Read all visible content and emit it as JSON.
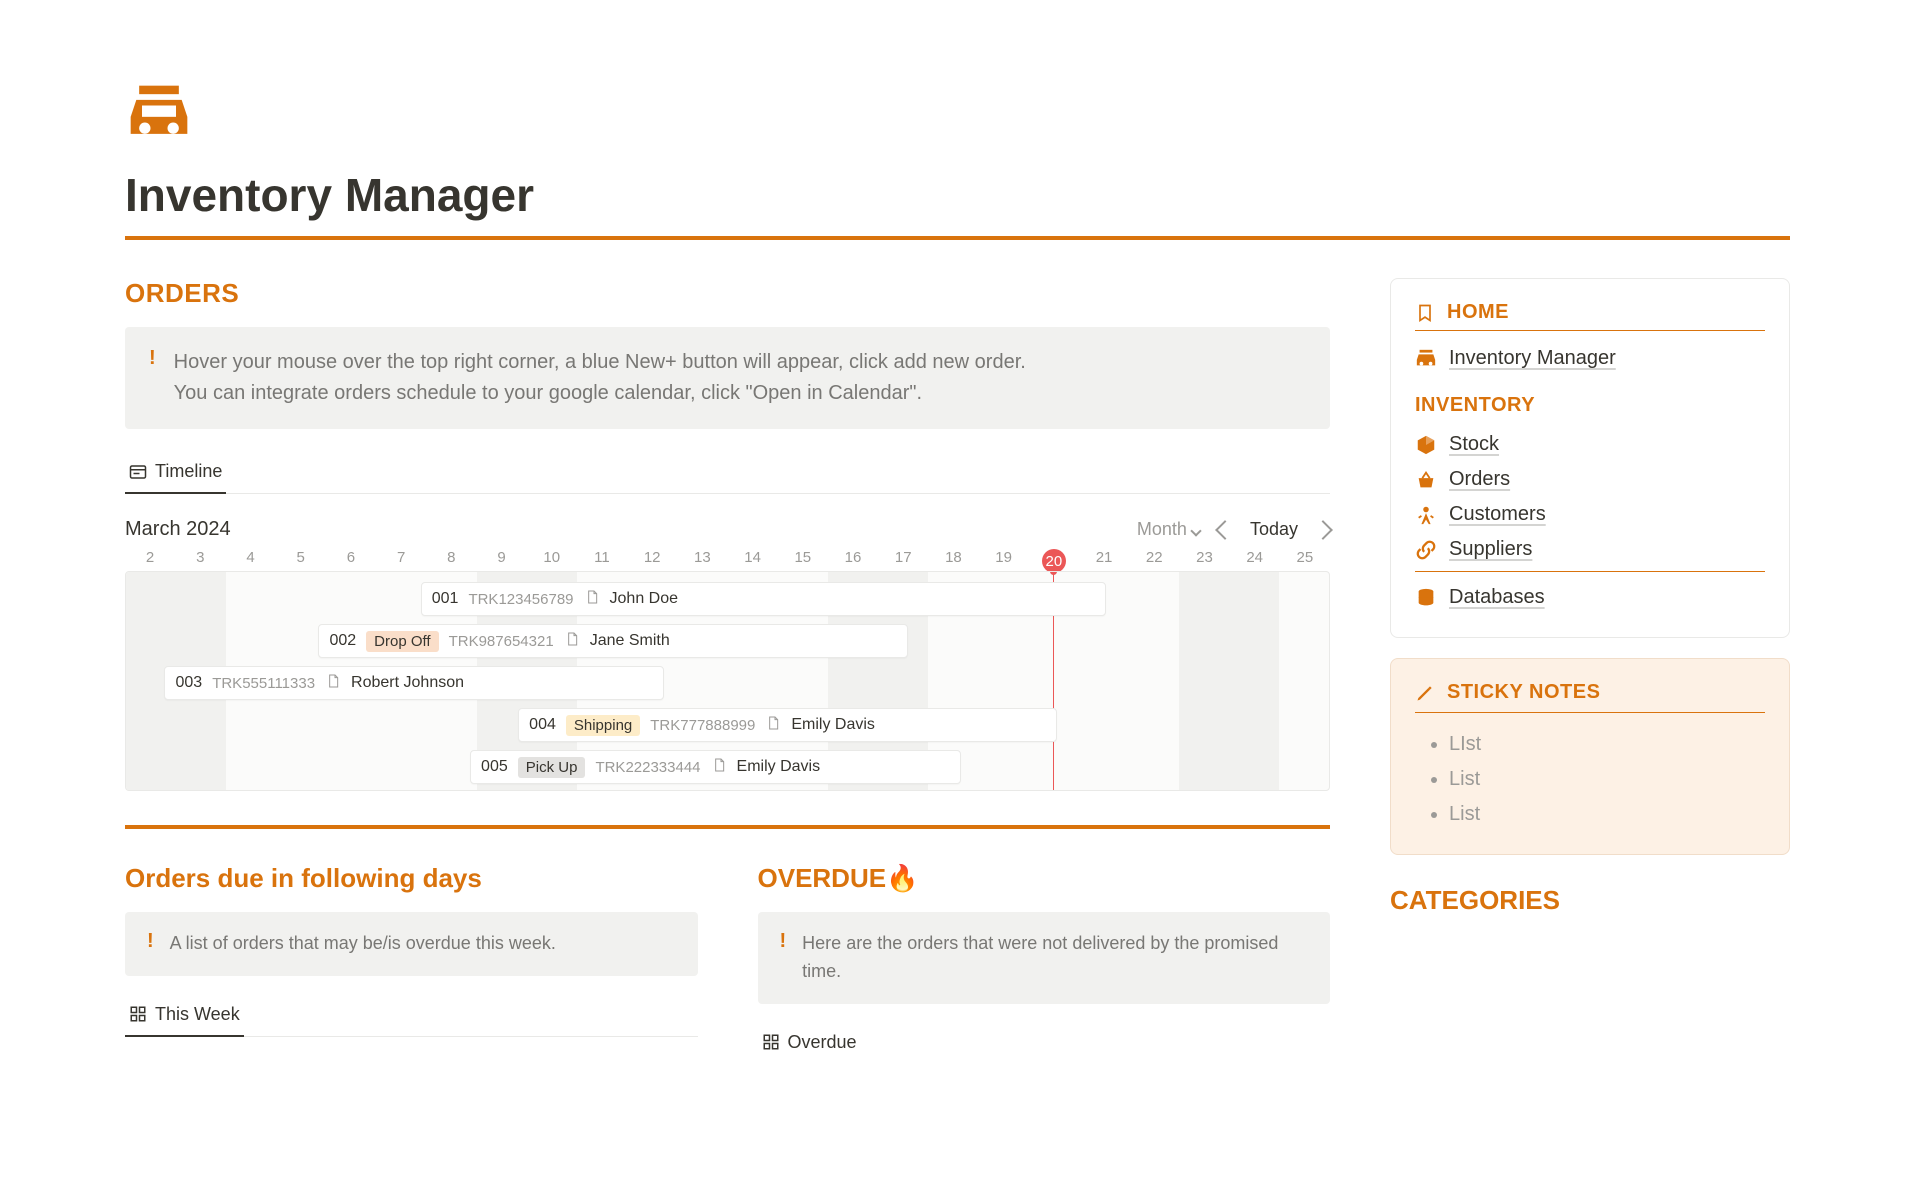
{
  "page": {
    "title": "Inventory Manager"
  },
  "orders": {
    "title": "ORDERS",
    "callout_line1": "Hover your mouse over the top right corner, a blue New+ button will appear, click add new order.",
    "callout_line2": "You can integrate orders schedule to your google calendar, click \"Open in Calendar\".",
    "tab_label": "Timeline",
    "month_label": "March 2024",
    "view_label": "Month",
    "today_label": "Today",
    "days": [
      "2",
      "3",
      "4",
      "5",
      "6",
      "7",
      "8",
      "9",
      "10",
      "11",
      "12",
      "13",
      "14",
      "15",
      "16",
      "17",
      "18",
      "19",
      "20",
      "21",
      "22",
      "23",
      "24",
      "25"
    ],
    "today_index": 18,
    "weekend_indices": [
      0,
      1,
      7,
      8,
      14,
      15,
      21,
      22
    ],
    "rows": [
      {
        "id": "001",
        "trk": "TRK123456789",
        "person": "John Doe",
        "badge": null,
        "left_pct": 24.5,
        "width_pct": 57
      },
      {
        "id": "002",
        "trk": "TRK987654321",
        "person": "Jane Smith",
        "badge": "Drop Off",
        "badge_class": "drop",
        "left_pct": 16,
        "width_pct": 49
      },
      {
        "id": "003",
        "trk": "TRK555111333",
        "person": "Robert Johnson",
        "badge": null,
        "left_pct": 3.2,
        "width_pct": 41.5
      },
      {
        "id": "004",
        "trk": "TRK777888999",
        "person": "Emily Davis",
        "badge": "Shipping",
        "badge_class": "ship",
        "left_pct": 32.6,
        "width_pct": 44.8
      },
      {
        "id": "005",
        "trk": "TRK222333444",
        "person": "Emily Davis",
        "badge": "Pick Up",
        "badge_class": "pick",
        "left_pct": 28.6,
        "width_pct": 40.8
      }
    ]
  },
  "due": {
    "title": "Orders due in following days",
    "callout": "A list of orders that may be/is overdue this week.",
    "tab": "This Week"
  },
  "overdue": {
    "title": "OVERDUE🔥",
    "callout": "Here are the orders that were not delivered by the promised time.",
    "tab": "Overdue"
  },
  "sidebar": {
    "home": "HOME",
    "home_link": "Inventory Manager",
    "inventory": "INVENTORY",
    "links": {
      "stock": "Stock",
      "orders": "Orders",
      "customers": "Customers",
      "suppliers": "Suppliers",
      "databases": "Databases"
    },
    "sticky_title": "STICKY NOTES",
    "sticky_items": [
      "LIst",
      "List",
      "List"
    ],
    "categories": "CATEGORIES"
  }
}
